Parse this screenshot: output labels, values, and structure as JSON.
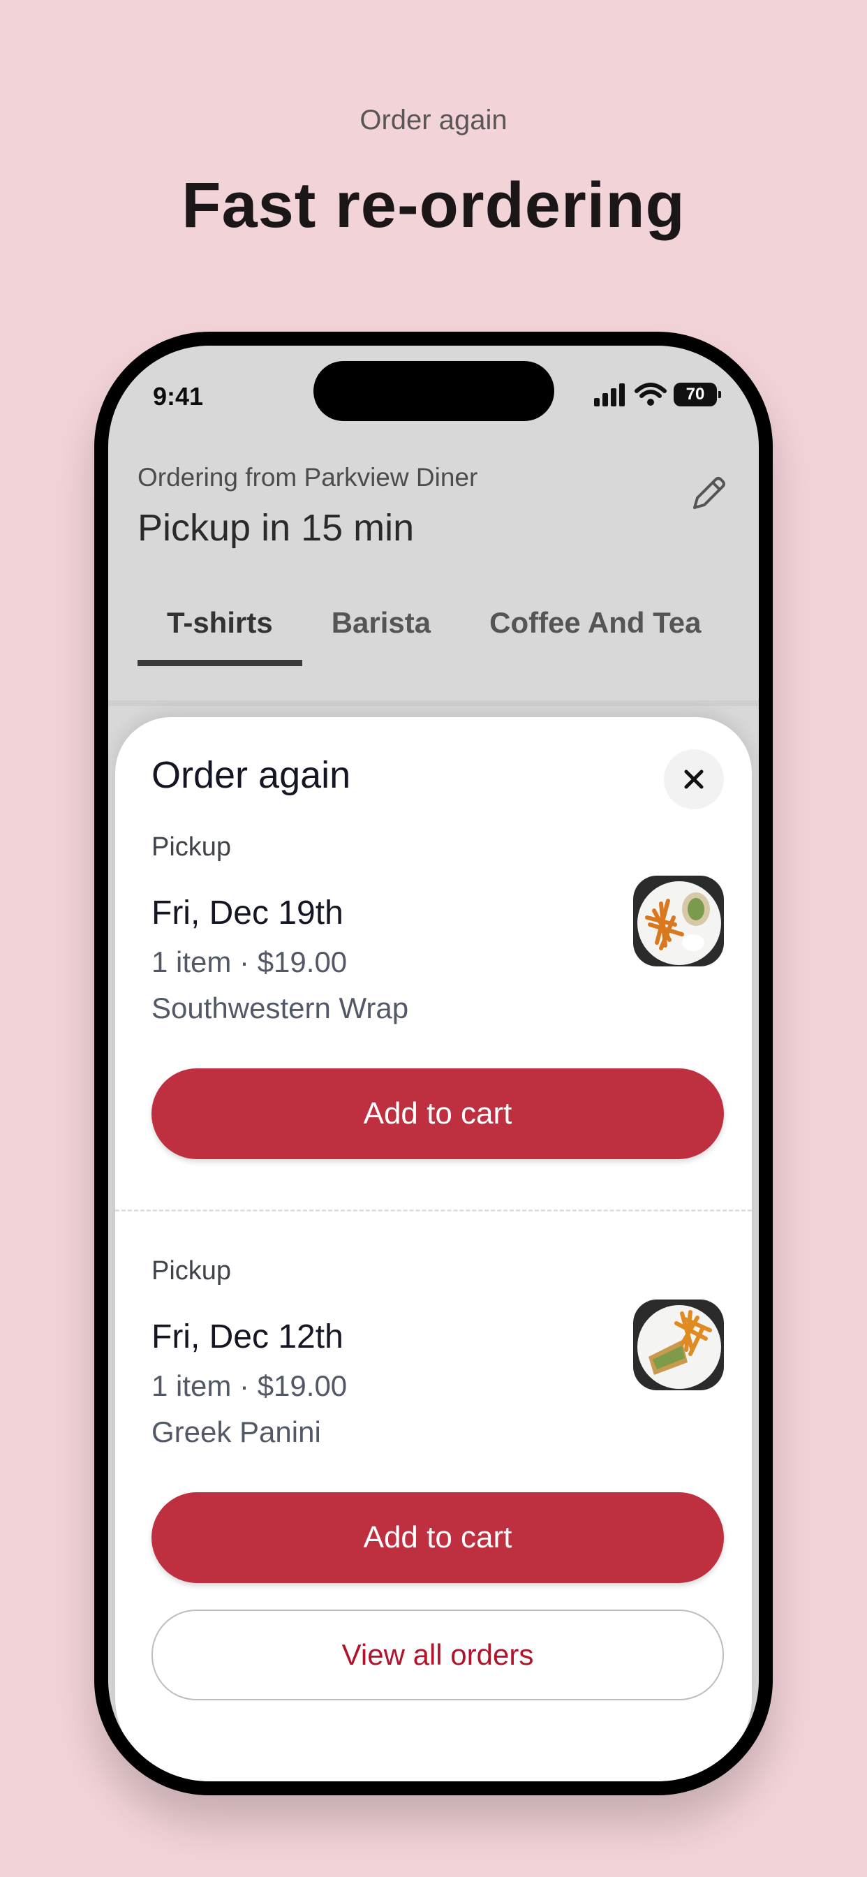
{
  "promo": {
    "eyebrow": "Order again",
    "headline": "Fast re-ordering"
  },
  "status_bar": {
    "time": "9:41",
    "battery": "70",
    "icons": [
      "signal-icon",
      "wifi-icon",
      "battery-icon"
    ]
  },
  "header": {
    "ordering_from": "Ordering from Parkview Diner",
    "pickup_time": "Pickup in 15 min",
    "edit_icon": "pencil-icon"
  },
  "tabs": [
    {
      "label": "T-shirts",
      "active": true
    },
    {
      "label": "Barista",
      "active": false
    },
    {
      "label": "Coffee And Tea",
      "active": false
    }
  ],
  "sheet": {
    "title": "Order again",
    "close_icon": "close-icon",
    "orders": [
      {
        "type": "Pickup",
        "date": "Fri, Dec 19th",
        "summary": "1 item · $19.00",
        "item_name": "Southwestern Wrap",
        "thumb_icon": "food-photo-icon",
        "button": "Add to cart"
      },
      {
        "type": "Pickup",
        "date": "Fri, Dec 12th",
        "summary": "1 item · $19.00",
        "item_name": "Greek Panini",
        "thumb_icon": "food-photo-icon",
        "button": "Add to cart"
      }
    ],
    "view_all": "View all orders"
  },
  "colors": {
    "background": "#f2d3d8",
    "accent": "#be2f3f",
    "link": "#b0142b"
  }
}
